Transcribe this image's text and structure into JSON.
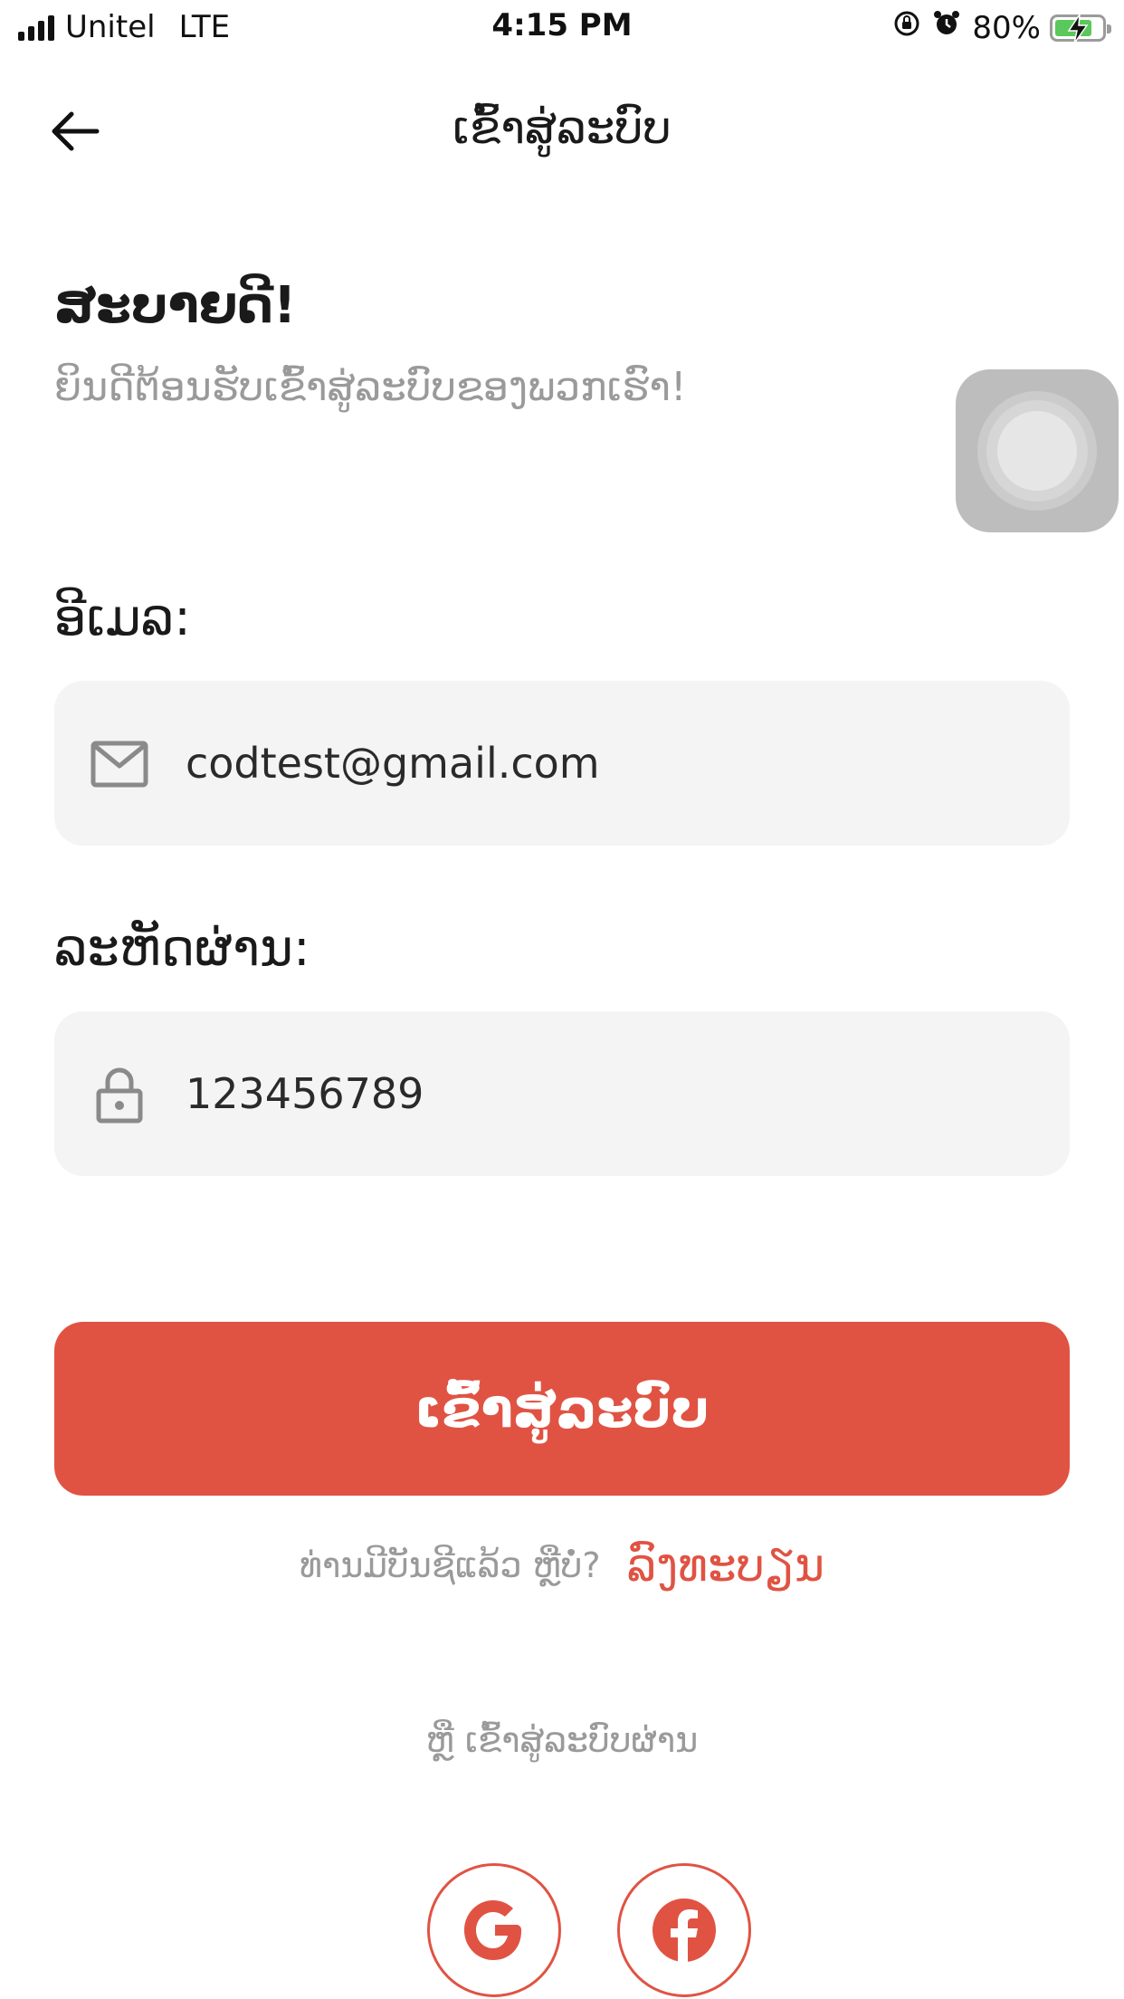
{
  "status_bar": {
    "carrier": "Unitel",
    "network": "LTE",
    "time": "4:15 PM",
    "battery_percent": "80%",
    "battery_level": 0.8,
    "battery_color": "#5ac85a"
  },
  "nav": {
    "title": "ເຂົ້າສູ່ລະບົບ",
    "back_icon": "arrow-left-icon"
  },
  "greeting": {
    "title": "ສະບາຍດີ!",
    "subtitle": "ຍິນດີຕ້ອນຮັບເຂົ້າສູ່ລະບົບຂອງພວກເຮົາ!"
  },
  "email": {
    "label": "ອີເມລ:",
    "value": "codtest@gmail.com",
    "icon": "mail-icon"
  },
  "password": {
    "label": "ລະຫັດຜ່ານ:",
    "value": "123456789",
    "icon": "lock-icon"
  },
  "login_button": {
    "label": "ເຂົ້າສູ່ລະບົບ"
  },
  "register": {
    "question": "ທ່ານມີບັນຊີແລ້ວ ຫຼືບໍ່?",
    "link": "ລົງທະບຽນ"
  },
  "social": {
    "or_text": "ຫຼື ເຂົ້າສູ່ລະບົບຜ່ານ",
    "providers": [
      "google-icon",
      "facebook-icon"
    ]
  },
  "colors": {
    "accent": "#e05343",
    "field_bg": "#f4f4f4",
    "muted_text": "#9a9a9a"
  }
}
